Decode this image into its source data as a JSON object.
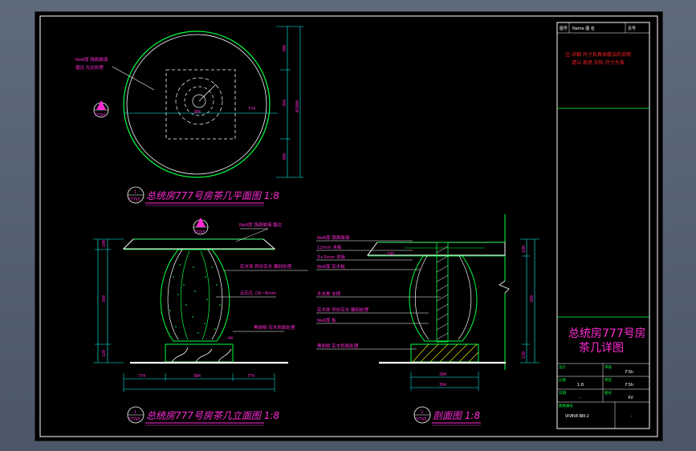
{
  "plan": {
    "title": "总统房777号房茶几平面图 1:8",
    "badge_top": "1",
    "badge_bottom": "777Ⅱ5",
    "side_badge_top": "1",
    "side_badge_bottom": "777Ⅱ5",
    "callout_line1": "Ne6厚 强面玻璃",
    "callout_line2": "磨边 光边处理",
    "dim_left": "384",
    "dim_right": "774",
    "dim_v1": "300",
    "dim_v2": "384",
    "dim_v3": "300",
    "dim_total": "Ø1000"
  },
  "elevation": {
    "title": "总统房777号房茶几立面图 1:8",
    "badge_top": "1",
    "badge_bottom": "777Ⅱ5",
    "section_badge_top": "2",
    "section_badge_bottom": "777Ⅱ5",
    "callouts": [
      "Ne6厚 强面玻璃 磨边",
      "实木饰 异形实木 雕刻处理",
      "云石孔 ∅6~8mm",
      "黑胡桃 实木饰面处理"
    ],
    "dim_h1": "100",
    "dim_h2": "380",
    "dim_h3": "120",
    "dim_b1": "774",
    "dim_b2": "384",
    "dim_b3": "774",
    "dim_base": "44"
  },
  "section": {
    "title": "剖面图 1:8",
    "badge_top": "2",
    "badge_bottom": "777Ⅱ5",
    "callouts": [
      "Ne6厚 强面玻璃",
      "12mm 夹板",
      "3+3mm 夹板",
      "Ne6厚 实木板",
      "木龙骨 支撑",
      "实木饰 异形实木 雕刻处理",
      "Ne6厚 板",
      "黑胡桃 实木饰面处理"
    ],
    "dim_top": "100",
    "dim_b1": "384",
    "dim_b2": "384",
    "dim_h1": "100",
    "dim_h2": "380",
    "dim_h3": "120"
  },
  "title_block": {
    "header_left": "图号",
    "header_mid": "Name  图 名",
    "header_right": "页号",
    "note_line1": "注:详细 尺寸及具体做法的说明",
    "note_line2": "请以 现场 实际 尺寸为准",
    "drawing_title_line1": "总统房777号房",
    "drawing_title_line2": "茶几详图",
    "row1_left_label": "设计",
    "row1_right_label": "审核",
    "row1_right_value": "F.Sh",
    "row2_left_label": "比例",
    "row2_left_value": "1:8",
    "row2_right_label": "审定",
    "row2_right_value": "F.Sh",
    "row3_left_label": "日期",
    "row3_left_value": "-",
    "row3_right_label": "图号",
    "row3_right_value": "XV",
    "row4_label": "图纸编号",
    "row4_value": "ⅥⅦⅦ ⅡⅡⅡ-2",
    "row4_right": "-"
  }
}
